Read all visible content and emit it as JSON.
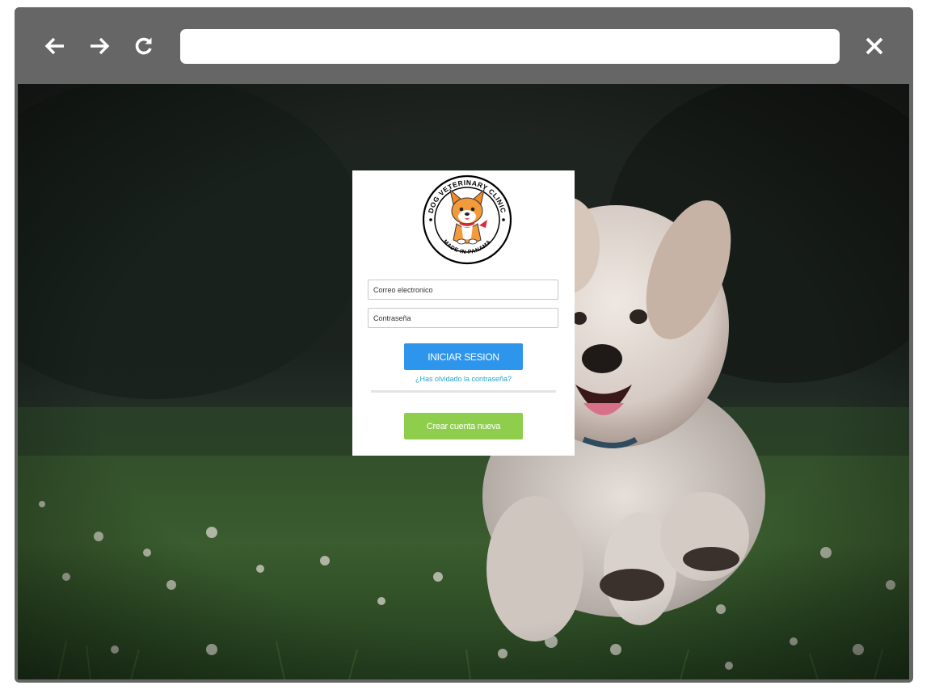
{
  "browser": {
    "back_icon": "arrow-left-icon",
    "forward_icon": "arrow-right-icon",
    "reload_icon": "reload-icon",
    "close_icon": "close-icon",
    "address_value": ""
  },
  "login": {
    "logo": {
      "top_text": "DOG VETERINARY CLINIC",
      "bottom_text": "MADE IN PANAMA"
    },
    "email_placeholder": "Correo electronico",
    "password_placeholder": "Contraseña",
    "login_button": "INICIAR SESION",
    "forgot_link": "¿Has olvidado la contraseña?",
    "create_button": "Crear cuenta nueva"
  },
  "colors": {
    "login_button": "#2d95ec",
    "create_button": "#8fce4c",
    "link": "#2aa3c6",
    "browser_chrome": "#666666"
  }
}
